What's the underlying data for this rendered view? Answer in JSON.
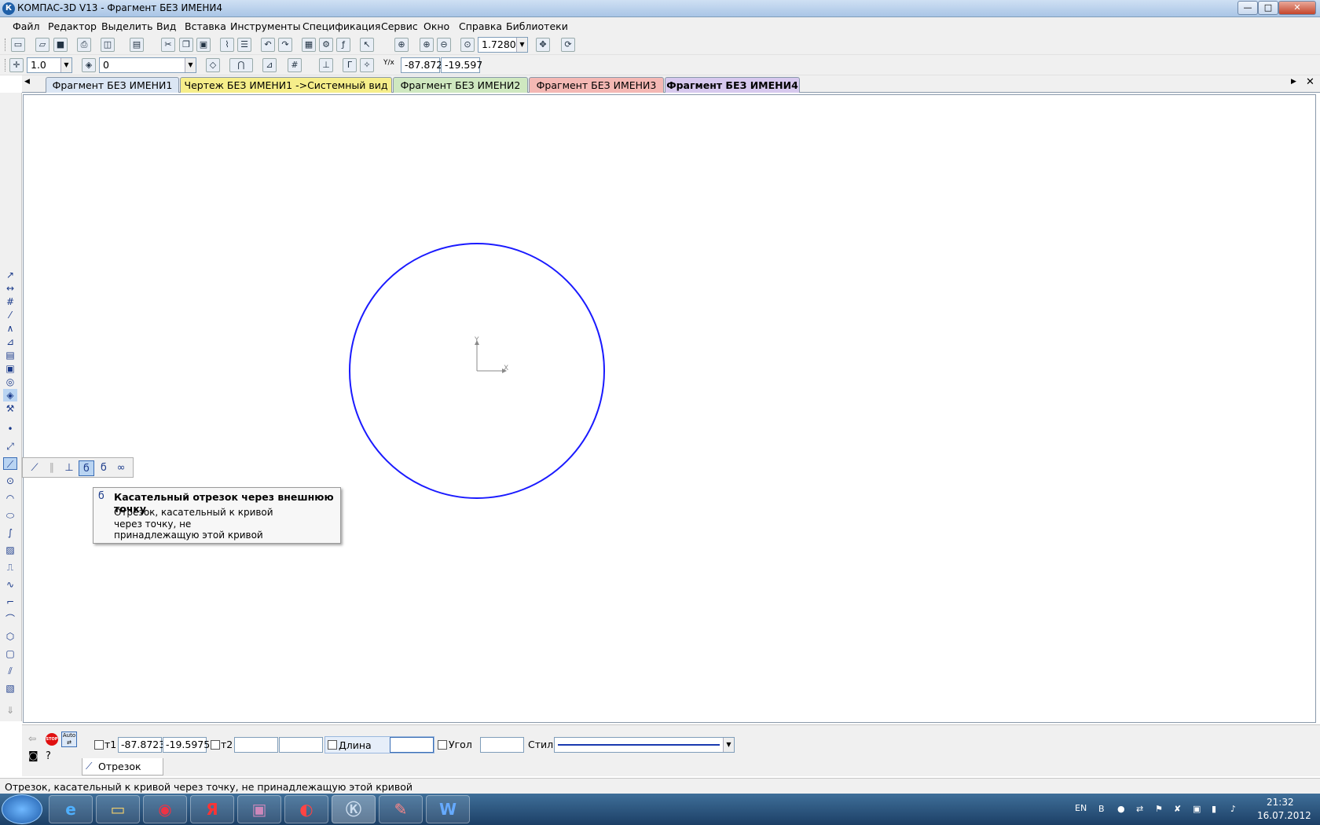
{
  "window": {
    "title": "КОМПАС-3D V13 - Фрагмент БЕЗ ИМЕНИ4",
    "app_icon": "К",
    "minimize": "—",
    "maximize": "□",
    "close": "✕"
  },
  "menu": [
    "Файл",
    "Редактор",
    "Выделить",
    "Вид",
    "Вставка",
    "Инструменты",
    "Спецификация",
    "Сервис",
    "Окно",
    "Справка",
    "Библиотеки"
  ],
  "toolbar1": {
    "zoom_value": "1.7280"
  },
  "toolbar2": {
    "step_value": "1.0",
    "layer_value": "0",
    "coord_x": "-87.872",
    "coord_y": "-19.597",
    "coord_axis_label": "Y/x"
  },
  "tabs": [
    {
      "label": "Фрагмент БЕЗ ИМЕНИ1",
      "color": "#dbe6f4",
      "active": false
    },
    {
      "label": "Чертеж БЕЗ ИМЕНИ1 ->Системный вид",
      "color": "#f6ee8a",
      "active": false
    },
    {
      "label": "Фрагмент БЕЗ ИМЕНИ2",
      "color": "#cfe8c0",
      "active": false
    },
    {
      "label": "Фрагмент БЕЗ ИМЕНИ3",
      "color": "#f4b8b4",
      "active": false
    },
    {
      "label": "Фрагмент БЕЗ ИМЕНИ4",
      "color": "#d7c9ee",
      "active": true
    }
  ],
  "tab_nav": {
    "left": "◀",
    "right": "▶",
    "close": "✕"
  },
  "canvas": {
    "circle_color": "#1a1aff",
    "axis_x_label": "X",
    "axis_y_label": "Y"
  },
  "tooltip": {
    "title": "Касательный отрезок через внешнюю точку",
    "description": "Отрезок, касательный к кривой через точку, не принадлежащую этой кривой"
  },
  "propbar": {
    "t1_label": "т1",
    "t1_x": "-87.8723",
    "t1_y": "-19.5975",
    "t2_label": "т2",
    "length_label": "Длина",
    "angle_label": "Угол",
    "style_label": "Стиль",
    "stop_label": "STOP",
    "auto_label": "Auto",
    "object_tab_label": "Отрезок"
  },
  "status": {
    "text": "Отрезок, касательный к кривой через точку, не принадлежащую этой кривой"
  },
  "taskbar": {
    "lang": "EN",
    "time": "21:32",
    "date": "16.07.2012",
    "yandex_label": "Я"
  }
}
